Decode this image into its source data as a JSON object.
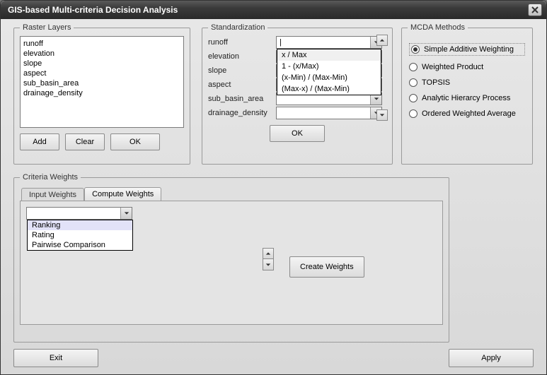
{
  "window": {
    "title": "GIS-based Multi-criteria Decision Analysis"
  },
  "raster": {
    "legend": "Raster Layers",
    "items": [
      "runoff",
      "elevation",
      "slope",
      "aspect",
      "sub_basin_area",
      "drainage_density"
    ],
    "add": "Add",
    "clear": "Clear",
    "ok": "OK"
  },
  "std": {
    "legend": "Standardization",
    "rows": [
      "runoff",
      "elevation",
      "slope",
      "aspect",
      "sub_basin_area",
      "drainage_density"
    ],
    "open_value": "|",
    "options": [
      "x / Max",
      "1 - (x/Max)",
      "(x-Min) / (Max-Min)",
      "(Max-x) / (Max-Min)"
    ],
    "ok": "OK"
  },
  "mcda": {
    "legend": "MCDA Methods",
    "options": [
      "Simple Additive Weighting",
      "Weighted Product",
      "TOPSIS",
      "Analytic Hierarcy Process",
      "Ordered Weighted Average"
    ],
    "selected_index": 0
  },
  "cw": {
    "legend": "Criteria Weights",
    "tabs": [
      "Input Weights",
      "Compute Weights"
    ],
    "active_tab": 1,
    "combo_value": "",
    "combo_options": [
      "Ranking",
      "Rating",
      "Pairwise Comparison"
    ],
    "create": "Create Weights"
  },
  "bottom": {
    "exit": "Exit",
    "apply": "Apply"
  }
}
